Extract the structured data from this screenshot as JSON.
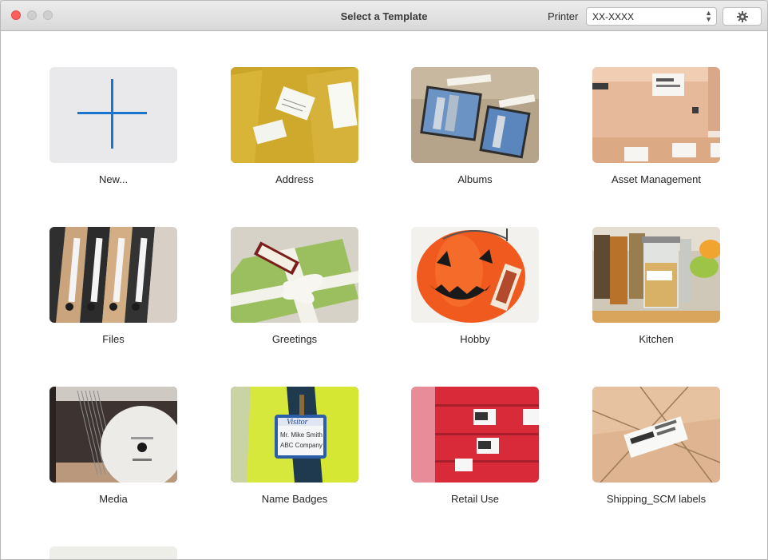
{
  "window": {
    "title": "Select a Template"
  },
  "toolbar": {
    "printer_label": "Printer",
    "printer_value": "XX-XXXX"
  },
  "templates": [
    {
      "label": "New...",
      "icon": "plus-icon"
    },
    {
      "label": "Address",
      "image": "padded-envelopes-with-address-labels"
    },
    {
      "label": "Albums",
      "image": "photo-album-with-labels"
    },
    {
      "label": "Asset Management",
      "image": "shipping-boxes-with-barcode-labels"
    },
    {
      "label": "Files",
      "image": "binders-with-spine-labels"
    },
    {
      "label": "Greetings",
      "image": "gift-box-with-ribbon-and-tag"
    },
    {
      "label": "Hobby",
      "image": "halloween-pumpkin-bucket"
    },
    {
      "label": "Kitchen",
      "image": "spice-jars-with-garlic-label"
    },
    {
      "label": "Media",
      "image": "cd-disc-with-label"
    },
    {
      "label": "Name Badges",
      "image": "visitor-name-badge",
      "badge_text": [
        "Visitor",
        "Mr. Mike Smith",
        "ABC Company"
      ]
    },
    {
      "label": "Retail Use",
      "image": "red-shoe-boxes-with-barcode-labels"
    },
    {
      "label": "Shipping_SCM labels",
      "image": "parcel-with-shipping-label"
    }
  ],
  "colors": {
    "accent": "#1a75cf",
    "close_button": "#fc605c"
  }
}
